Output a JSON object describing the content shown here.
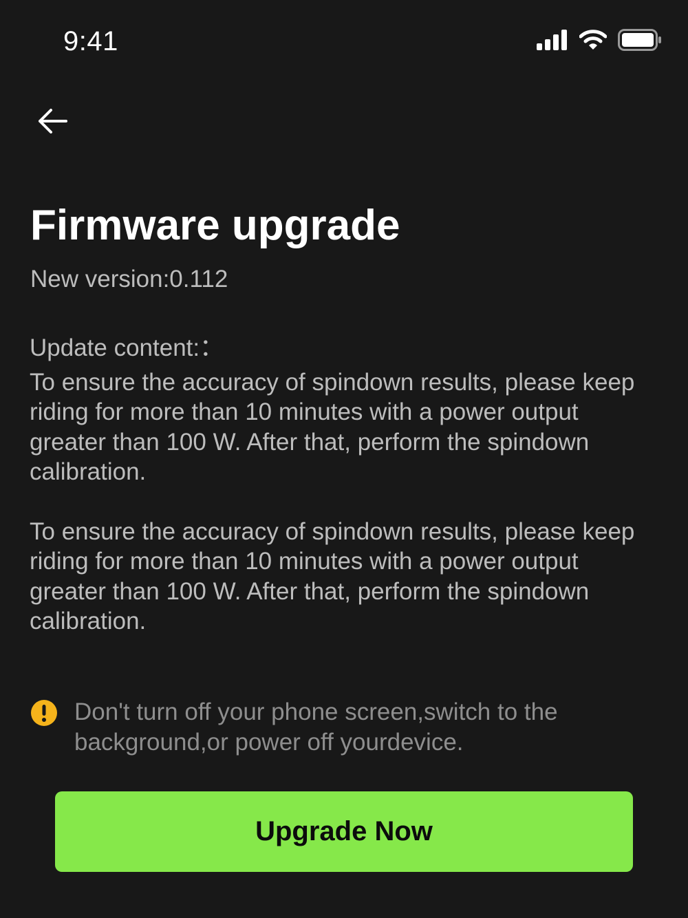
{
  "status_bar": {
    "time": "9:41",
    "icons": [
      "cellular-signal-icon",
      "wifi-icon",
      "battery-icon"
    ]
  },
  "nav": {
    "back_icon": "arrow-left-icon"
  },
  "header": {
    "title": "Firmware upgrade",
    "version": "New version:0.112"
  },
  "update": {
    "heading": "Update content:：",
    "paragraphs": [
      "To ensure the accuracy of spindown results, please keep riding for more than 10 minutes with a power output greater than 100 W. After that, perform the spindown calibration.",
      "To ensure the accuracy of spindown results, please keep riding for more than 10 minutes with a power output greater than 100 W. After that, perform the spindown calibration."
    ]
  },
  "notice": {
    "icon": "warning-icon",
    "text": "Don't turn off your phone screen,switch to the background,or power off yourdevice."
  },
  "action": {
    "upgrade_label": "Upgrade Now"
  },
  "colors": {
    "background": "#181818",
    "accent": "#86e84a",
    "warning": "#f5b31b",
    "text_secondary": "#bdbdbd",
    "text_muted": "#8e8e8e"
  }
}
